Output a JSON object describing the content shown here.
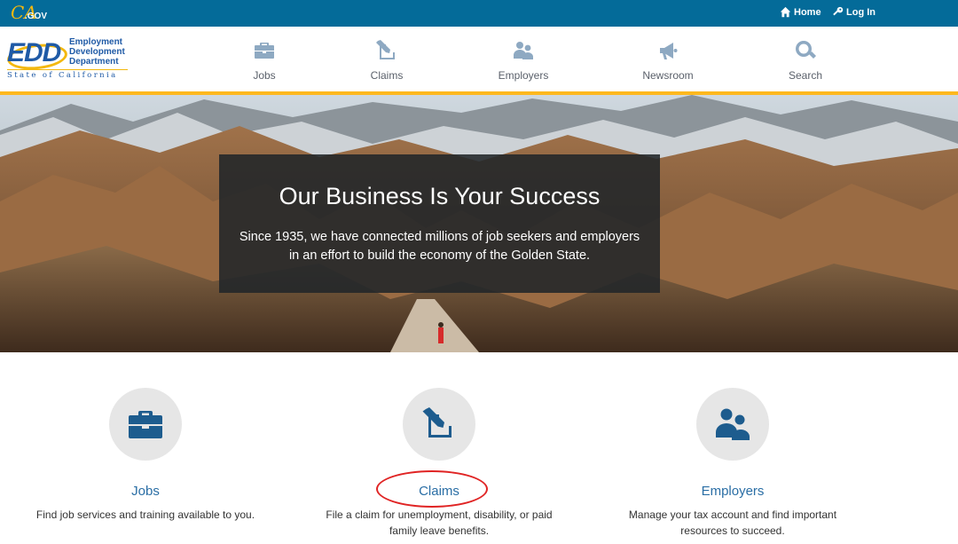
{
  "topbar": {
    "cagov_logo": "CA",
    "cagov_suffix": ".GOV",
    "home_label": "Home",
    "login_label": "Log In"
  },
  "logo": {
    "mark": "EDD",
    "line1": "Employment",
    "line2": "Development",
    "line3": "Department",
    "state": "State of California"
  },
  "nav": {
    "items": [
      {
        "label": "Jobs",
        "icon": "briefcase-icon"
      },
      {
        "label": "Claims",
        "icon": "edit-icon"
      },
      {
        "label": "Employers",
        "icon": "people-icon"
      },
      {
        "label": "Newsroom",
        "icon": "megaphone-icon"
      },
      {
        "label": "Search",
        "icon": "search-icon"
      }
    ]
  },
  "hero": {
    "title": "Our Business Is Your Success",
    "text_line1": "Since 1935, we have connected millions of job seekers and employers",
    "text_line2": "in an effort to build the economy of the Golden State."
  },
  "cards": [
    {
      "title": "Jobs",
      "desc": "Find job services and training available to you.",
      "icon": "briefcase-icon"
    },
    {
      "title": "Claims",
      "desc": "File a claim for unemployment, disability, or paid family leave benefits.",
      "icon": "edit-icon"
    },
    {
      "title": "Employers",
      "desc": "Manage your tax account and find important resources to succeed.",
      "icon": "people-icon"
    }
  ],
  "colors": {
    "topbar": "#046b99",
    "accent_gold": "#fdb81e",
    "link_blue": "#2a6ea5",
    "icon_blue": "#1d5c8e",
    "highlight_red": "#e02424"
  }
}
